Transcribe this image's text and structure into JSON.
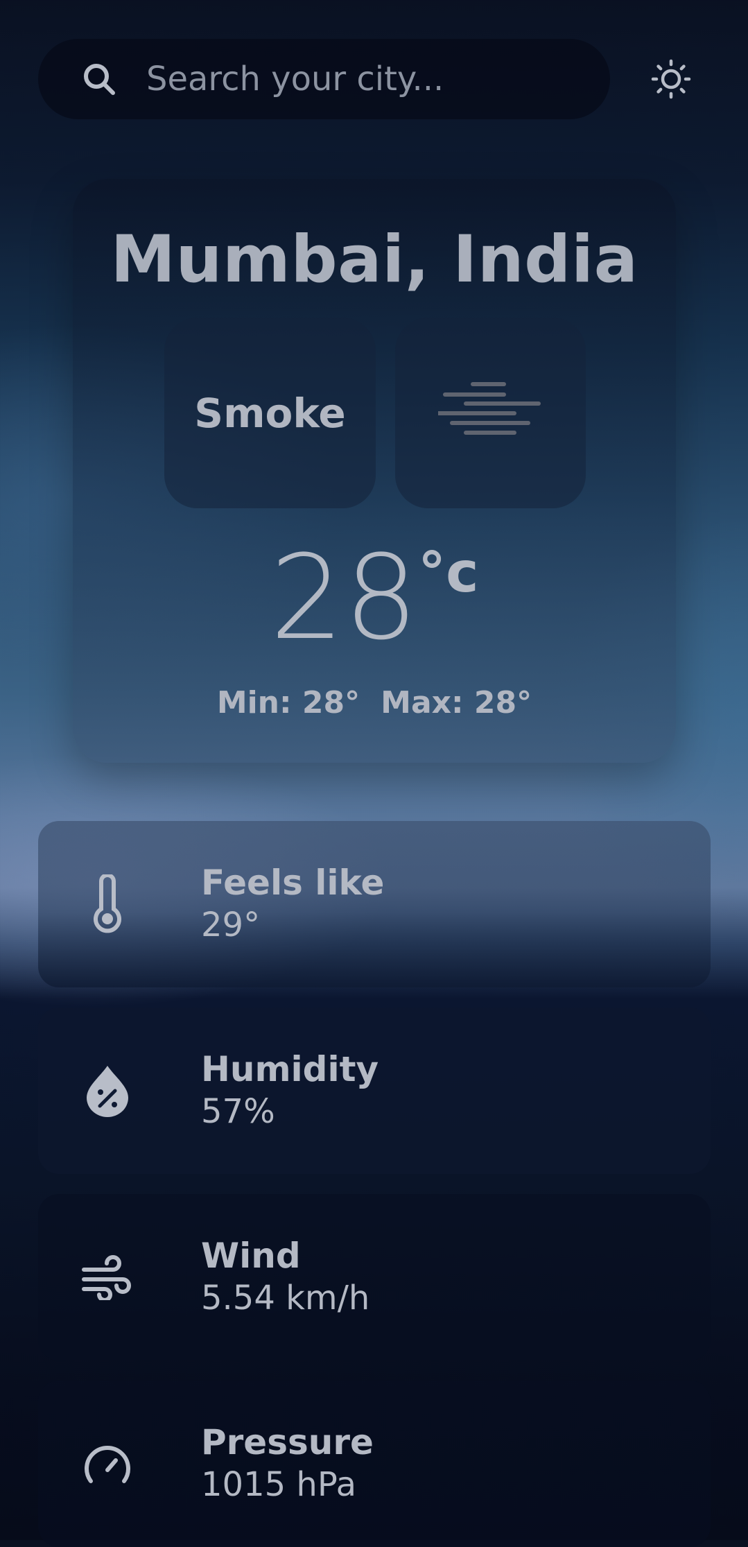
{
  "search": {
    "placeholder": "Search your city..."
  },
  "icons": {
    "search": "search-icon",
    "theme": "sun-icon",
    "condition": "haze-icon",
    "feels_like": "thermometer-icon",
    "humidity": "humidity-drop-icon",
    "wind": "wind-icon",
    "pressure": "gauge-icon"
  },
  "weather": {
    "city": "Mumbai, India",
    "condition": "Smoke",
    "temperature": "28",
    "unit": "°c",
    "min": "Min: 28°",
    "max": "Max: 28°"
  },
  "stats": [
    {
      "label": "Feels like",
      "value": "29°"
    },
    {
      "label": "Humidity",
      "value": "57%"
    },
    {
      "label": "Wind",
      "value": "5.54 km/h"
    },
    {
      "label": "Pressure",
      "value": "1015 hPa"
    }
  ],
  "colors": {
    "text": "#aab3c2",
    "icon": "#b8bdc8",
    "background_dark": "#0a1122",
    "background_mid": "#3b6285"
  }
}
